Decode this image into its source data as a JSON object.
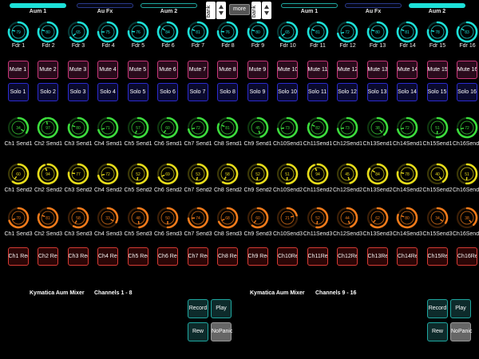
{
  "tabs": {
    "left": [
      "Aum 1",
      "Au Fx",
      "Aum 2"
    ],
    "right": [
      "Aum 1",
      "Au Fx",
      "Aum 2"
    ],
    "bank_left": "bank",
    "bank_right": "bank",
    "more": "more"
  },
  "faders": {
    "labels": [
      "Fdr 1",
      "Fdr 2",
      "Fdr 3",
      "Fdr 4",
      "Fdr 5",
      "Fdr 6",
      "Fdr 7",
      "Fdr 8",
      "Fdr 9",
      "Fdr 10",
      "Fdr 11",
      "Fdr 12",
      "Fdr 13",
      "Fdr 14",
      "Fdr 15",
      "Fdr 16"
    ],
    "values": [
      "79",
      "80",
      "65",
      "75",
      "76",
      "84",
      "81",
      "76",
      "80",
      "65",
      "81",
      "72",
      "80",
      "81",
      "78",
      "83"
    ],
    "levels": [
      0.79,
      0.8,
      0.65,
      0.75,
      0.76,
      0.84,
      0.81,
      0.76,
      0.8,
      0.65,
      0.81,
      0.72,
      0.8,
      0.81,
      0.78,
      0.83
    ]
  },
  "mute": [
    "Mute 1",
    "Mute 2",
    "Mute 3",
    "Mute 4",
    "Mute 5",
    "Mute 6",
    "Mute 7",
    "Mute 8",
    "Mute 9",
    "Mute 10",
    "Mute 11",
    "Mute 12",
    "Mute 13",
    "Mute 14",
    "Mute 15",
    "Mute 16"
  ],
  "solo": [
    "Solo 1",
    "Solo 2",
    "Solo 3",
    "Solo 4",
    "Solo 5",
    "Solo 6",
    "Solo 7",
    "Solo 8",
    "Solo 9",
    "Solo 10",
    "Solo 11",
    "Solo 12",
    "Solo 13",
    "Solo 14",
    "Solo 15",
    "Solo 16"
  ],
  "send1": {
    "labels": [
      "Ch1 Send1",
      "Ch2 Send1",
      "Ch3 Send1",
      "Ch4 Send1",
      "Ch5 Send1",
      "Ch6 Send1",
      "Ch7 Send1",
      "Ch8 Send1",
      "Ch9 Send1",
      "Ch10Send1",
      "Ch11Send1",
      "Ch12Send1",
      "Ch13Send1",
      "Ch14Send1",
      "Ch15Send1",
      "Ch16Send1"
    ],
    "values": [
      "34",
      "97",
      "80",
      "71",
      "57",
      "60",
      "72",
      "81",
      "45",
      "73",
      "82",
      "73",
      "38",
      "72",
      "51",
      "72"
    ],
    "levels": [
      0.34,
      0.97,
      0.8,
      0.71,
      0.57,
      0.6,
      0.72,
      0.81,
      0.45,
      0.73,
      0.82,
      0.73,
      0.38,
      0.72,
      0.51,
      0.72
    ]
  },
  "send2": {
    "labels": [
      "Ch1 Send2",
      "Ch2 Send2",
      "Ch3 Send2",
      "Ch4 Send2",
      "Ch5 Send2",
      "Ch6 Send2",
      "Ch7 Send2",
      "Ch8 Send2",
      "Ch9 Send2",
      "Ch10Send2",
      "Ch11Send2",
      "Ch12Send2",
      "Ch13Send2",
      "Ch14Send2",
      "Ch15Send2",
      "Ch16Send2"
    ],
    "values": [
      "60",
      "94",
      "77",
      "72",
      "52",
      "69",
      "53",
      "58",
      "52",
      "51",
      "94",
      "45",
      "84",
      "78",
      "40",
      "51"
    ],
    "levels": [
      0.6,
      0.94,
      0.77,
      0.72,
      0.52,
      0.69,
      0.53,
      0.58,
      0.52,
      0.51,
      0.94,
      0.45,
      0.84,
      0.78,
      0.4,
      0.51
    ]
  },
  "send3": {
    "labels": [
      "Ch1 Send3",
      "Ch2 Send3",
      "Ch3 Send3",
      "Ch4 Send3",
      "Ch5 Send3",
      "Ch6 Send3",
      "Ch7 Send3",
      "Ch8 Send3",
      "Ch9 Send3",
      "Ch10Send3",
      "Ch11Send3",
      "Ch12Send3",
      "Ch13Send3",
      "Ch14Send3",
      "Ch15Send3",
      "Ch16Send3"
    ],
    "values": [
      "70",
      "81",
      "58",
      "33",
      "48",
      "50",
      "74",
      "68",
      "60",
      "21",
      "52",
      "44",
      "62",
      "80",
      "34",
      "38"
    ],
    "levels": [
      0.7,
      0.81,
      0.58,
      0.33,
      0.48,
      0.5,
      0.74,
      0.68,
      0.6,
      0.21,
      0.52,
      0.44,
      0.62,
      0.8,
      0.34,
      0.38
    ]
  },
  "rec": [
    "Ch1 Rec",
    "Ch2 Rec",
    "Ch3 Rec",
    "Ch4 Rec",
    "Ch5 Rec",
    "Ch6 Rec",
    "Ch7 Rec",
    "Ch8 Rec",
    "Ch9 Rec",
    "Ch10Rec",
    "Ch11Rec",
    "Ch12Rec",
    "Ch13Rec",
    "Ch14Rec",
    "Ch15Rec",
    "Ch16Rec"
  ],
  "footer": {
    "left_title": "Kymatica Aum Mixer",
    "left_channels": "Channels 1 - 8",
    "right_title": "Kymatica Aum Mixer",
    "right_channels": "Channels 9 - 16"
  },
  "transport": {
    "record": "Record",
    "play": "Play",
    "rew": "Rew",
    "nopanic": "NoPanic"
  },
  "colors": {
    "fader": "#1de0d8",
    "send1": "#3cdc3c",
    "send2": "#e6dc1a",
    "send3": "#f07a1a",
    "mute": "#c9387a",
    "solo": "#2b2ad0",
    "rec": "#d63a34"
  }
}
